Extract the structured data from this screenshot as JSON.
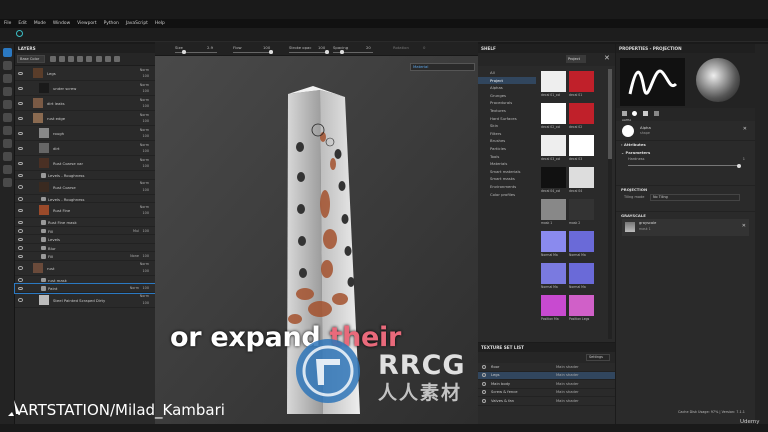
{
  "menu": [
    "File",
    "Edit",
    "Mode",
    "Window",
    "Viewport",
    "Python",
    "JavaScript",
    "Help"
  ],
  "toolbar": {
    "stroke_label": "Size",
    "size_value": "2.9",
    "flow_label": "Flow",
    "flow_value": "100",
    "stroke_opacity_label": "Stroke opac",
    "stroke_opacity_value": "100",
    "spacing_label": "Spacing",
    "spacing_value": "20",
    "rotation_label": "Rotation",
    "rotation_value": "0",
    "material_dropdown": "Material"
  },
  "layers": {
    "title": "LAYERS",
    "base_color_select": "Base Color",
    "rows": [
      {
        "name": "Legs",
        "blend": "Norm",
        "opacity": "100",
        "type": "folder"
      },
      {
        "name": "under screw",
        "blend": "Norm",
        "opacity": "100",
        "type": "layer"
      },
      {
        "name": "dirt leaks",
        "blend": "Norm",
        "opacity": "100",
        "type": "folder"
      },
      {
        "name": "rust edge",
        "blend": "Norm",
        "opacity": "100",
        "type": "folder"
      },
      {
        "name": "rough",
        "blend": "Norm",
        "opacity": "100",
        "type": "layer"
      },
      {
        "name": "dirt",
        "blend": "Norm",
        "opacity": "100",
        "type": "layer"
      },
      {
        "name": "Rust Coarse var",
        "blend": "Norm",
        "opacity": "100",
        "type": "layer"
      },
      {
        "name": "Levels - Roughness",
        "type": "effect"
      },
      {
        "name": "Rust Coarse",
        "blend": "Norm",
        "opacity": "100",
        "type": "layer"
      },
      {
        "name": "Levels - Roughness",
        "type": "effect"
      },
      {
        "name": "Rust Fine",
        "blend": "Norm",
        "opacity": "100",
        "type": "layer"
      },
      {
        "name": "Rust Fine mask",
        "type": "sub"
      },
      {
        "name": "Fill",
        "blend": "Mul",
        "opacity": "100",
        "type": "sub"
      },
      {
        "name": "Levels",
        "type": "sub"
      },
      {
        "name": "Blur",
        "type": "sub"
      },
      {
        "name": "Fill",
        "blend": "None",
        "opacity": "100",
        "type": "sub"
      },
      {
        "name": "rust",
        "blend": "Norm",
        "opacity": "100",
        "type": "folder"
      },
      {
        "name": "rust mask",
        "type": "sub"
      },
      {
        "name": "Paint",
        "blend": "Norm",
        "opacity": "100",
        "type": "sub"
      },
      {
        "name": "Steel Painted Scraped Dirty",
        "blend": "Norm",
        "opacity": "100",
        "type": "layer"
      }
    ]
  },
  "shelf": {
    "title": "SHELF",
    "search_tag": "Project",
    "categories": [
      "All",
      "Project",
      "Alphas",
      "Grunges",
      "Procedurals",
      "Textures",
      "Hard Surfaces",
      "Skin",
      "Filters",
      "Brushes",
      "Particles",
      "Tools",
      "Materials",
      "Smart materials",
      "Smart masks",
      "Environments",
      "Color profiles"
    ],
    "selected_category": "Project",
    "items": [
      "decal 01_col",
      "decal 01",
      "decal 02_col",
      "decal 02",
      "decal 03_col",
      "decal 03",
      "decal 04_col",
      "decal 04",
      "mask 1",
      "mask 2",
      "Normal Ma",
      "Normal Ma",
      "Normal Ma",
      "Normal Ma",
      "Position Ma",
      "Position Legs"
    ]
  },
  "texture_set_list": {
    "title": "TEXTURE SET LIST",
    "settings_label": "Settings",
    "rows": [
      {
        "name": "floor",
        "shader": "Main shader"
      },
      {
        "name": "Legs",
        "shader": "Main shader"
      },
      {
        "name": "Main body",
        "shader": "Main shader"
      },
      {
        "name": "Screw & fence",
        "shader": "Main shader"
      },
      {
        "name": "Valves & fan",
        "shader": "Main shader"
      }
    ]
  },
  "properties": {
    "title": "PROPERTIES - PROJECTION",
    "alpha_tab": "ALPHA",
    "alpha_label": "Alpha",
    "alpha_value": "shape",
    "attributes_label": "Attributes",
    "parameters_label": "Parameters",
    "hardness_label": "Hardness",
    "hardness_value": "1",
    "projection_label": "PROJECTION",
    "tiling_label": "Tiling mode",
    "tiling_value": "No Tiling",
    "grayscale_label": "GRAYSCALE",
    "grayscale_name": "grayscale",
    "grayscale_value": "mask 1"
  },
  "subtitle": {
    "part1": "or expand ",
    "part2": "their"
  },
  "watermark": {
    "brand": "RRCG",
    "cn": "人人素材"
  },
  "credit": "ARTSTATION/Milad_Kambari",
  "status": "Cache Disk Usage:   97%  |  Version: 7.1.1",
  "udemy": "Udemy",
  "colors": {
    "accent_blue": "#2b79c2",
    "highlight": "#e96a7b",
    "logo_cyan": "#3bbfc6"
  }
}
